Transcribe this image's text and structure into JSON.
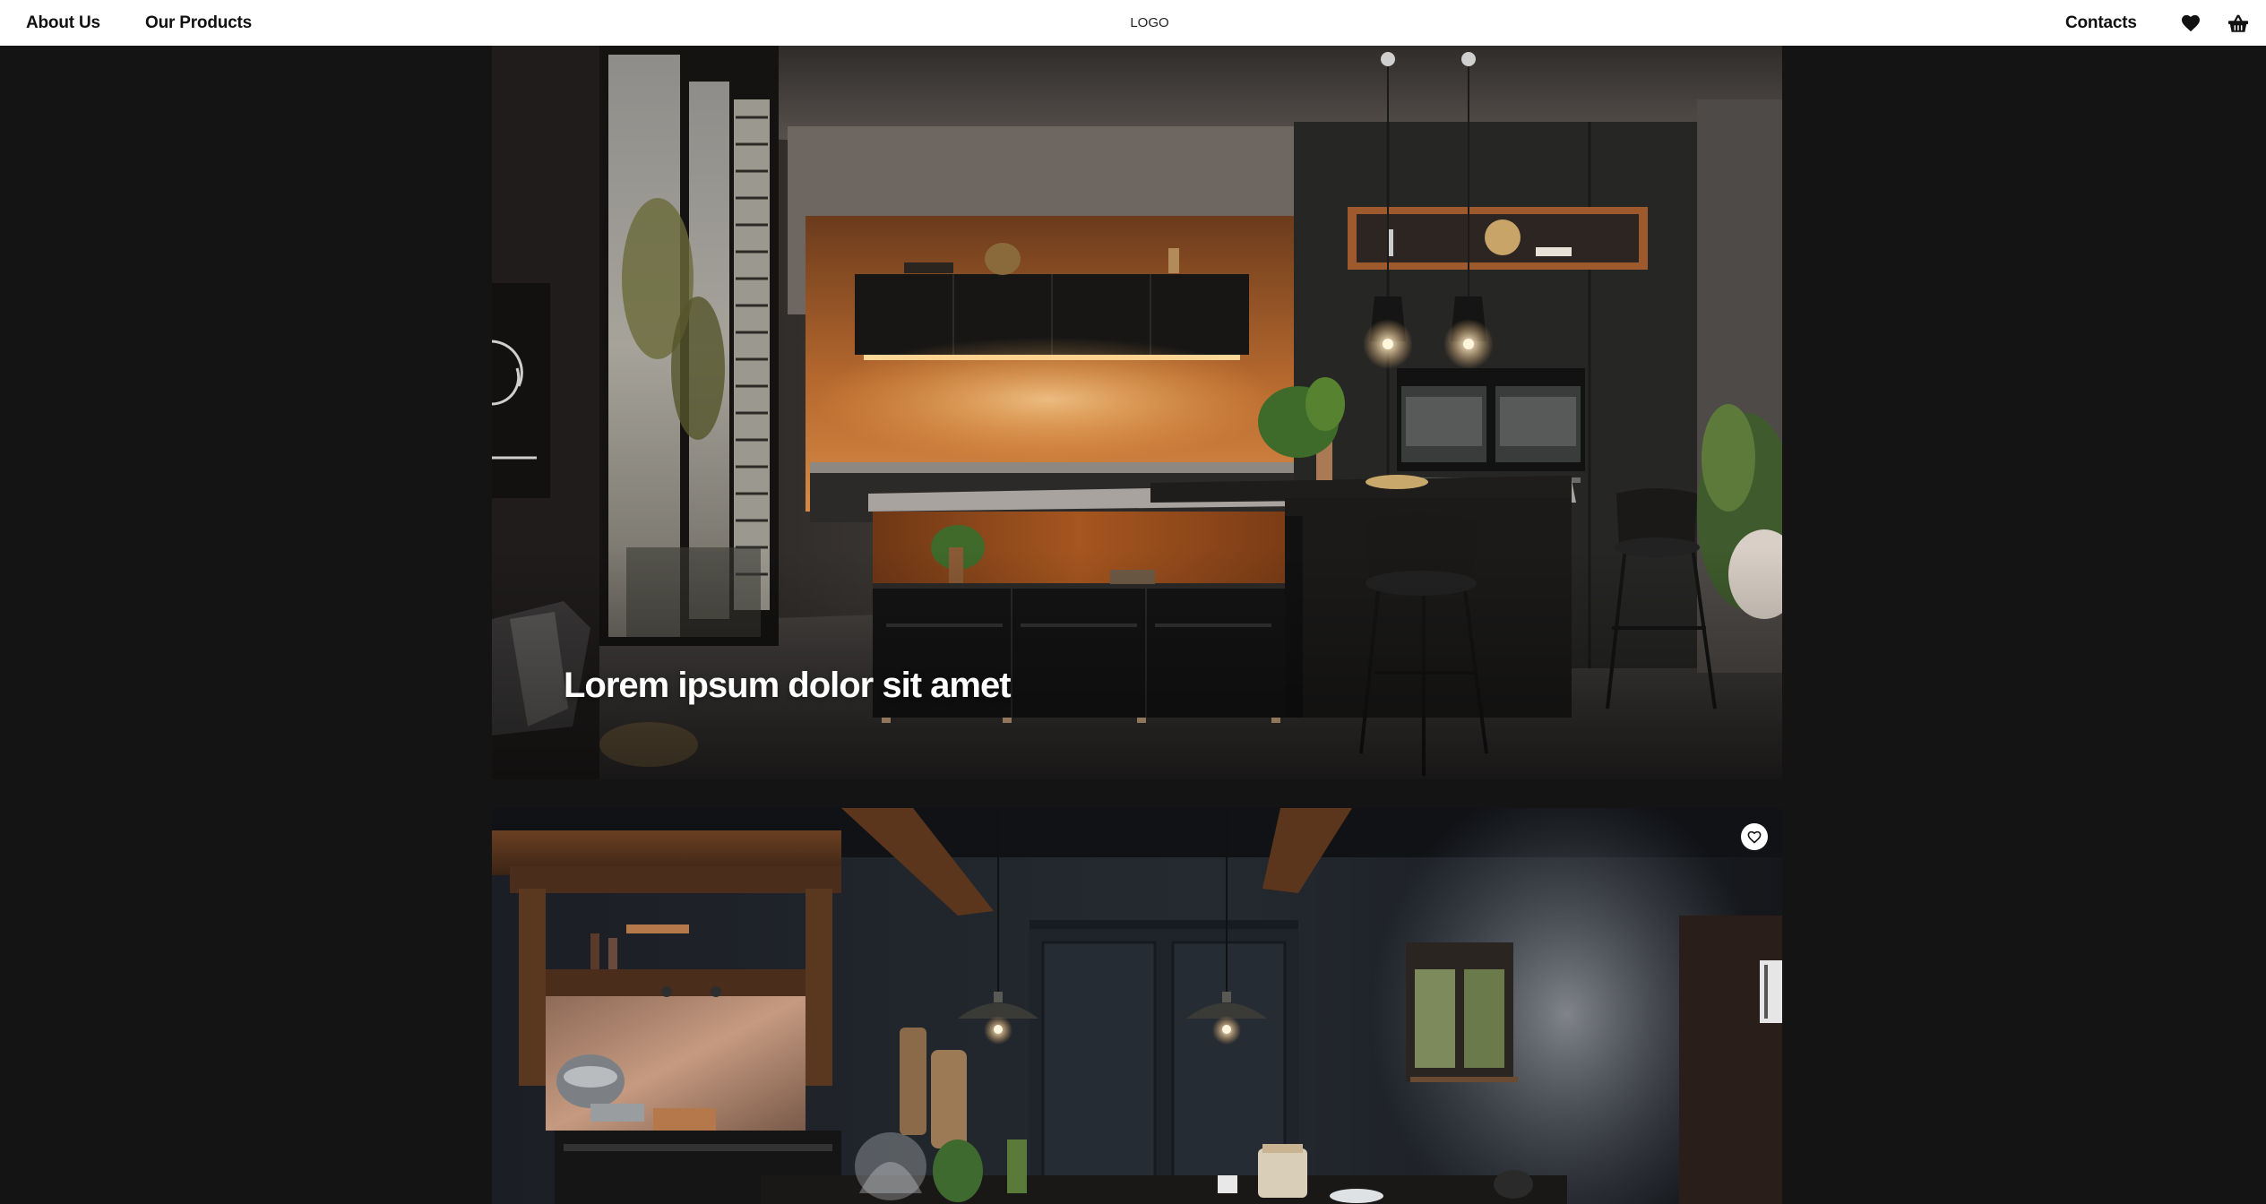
{
  "header": {
    "nav_left": [
      {
        "label": "About Us"
      },
      {
        "label": "Our Products"
      }
    ],
    "logo": "LOGO",
    "nav_right": {
      "label": "Contacts"
    },
    "icons": {
      "favorites": "heart-icon",
      "cart": "basket-icon"
    }
  },
  "cards": [
    {
      "caption": "Lorem ipsum dolor sit amet",
      "image": "modern-kitchen-photo"
    },
    {
      "caption": "",
      "image": "rustic-dark-kitchen-photo",
      "favorite_icon": "heart-outline-icon"
    }
  ],
  "colors": {
    "page_background": "#141414",
    "header_background": "#ffffff",
    "text_dark": "#111111",
    "caption_text": "#ffffff"
  }
}
